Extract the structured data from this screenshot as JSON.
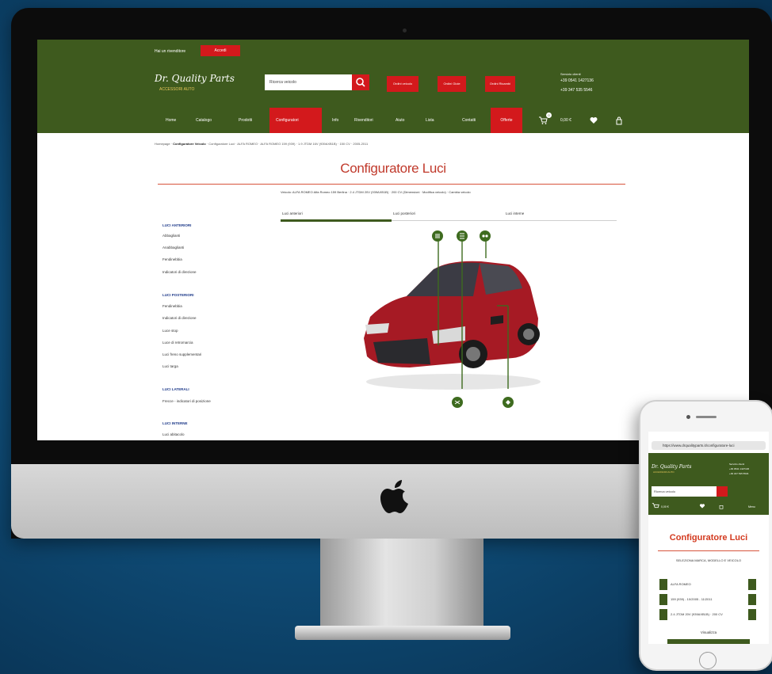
{
  "site": {
    "topbar_label": "Hai un rivenditore",
    "topbar_button": "Accedi",
    "logo_text": "Dr. Quality Parts",
    "logo_sub": "ACCESSORI AUTO",
    "search_placeholder": "Ricerca veicolo",
    "header_buttons": [
      "Ordini veicolo",
      "Ordini Gioie",
      "Ordini Ricambi"
    ],
    "contact_label": "Servizio clienti",
    "contact_lines": [
      "+39 0541 1427136",
      "+39 347 535 5546"
    ],
    "nav": [
      "Home",
      "Catalogo",
      "Prodotti",
      "Configuratori",
      "Info",
      "Rivenditori",
      "Aiuto",
      "Lista",
      "Contatti",
      "Offerte"
    ],
    "nav_active": "Configuratori",
    "nav_offer": "Offerte",
    "cart_count": "0",
    "cart_total": "0,00 €"
  },
  "breadcrumb": {
    "home": "Homepage",
    "section": "Configuratore Veicolo",
    "path": "Configuratore Luci · ALFA ROMEO · ALFA ROMEO 159 (939) · 1.9 JTDM 16V (939AXB1B) · 150 CV · 2005-2011"
  },
  "page": {
    "title": "Configuratore Luci",
    "note": "Veicolo: ALFA ROMEO Alfa Romeo 159 Berlina · 2.4 JTDM 20V (939AXB1B) · 200 CV (Dimensioni · Modifica veicolo) · Cambia veicolo"
  },
  "tabs": [
    "Luci anteriori",
    "Luci posteriori",
    "Luci interne"
  ],
  "sidebar": [
    {
      "group": "LUCI ANTERIORI",
      "items": [
        "Abbaglianti",
        "Anabbaglianti",
        "Fendinebbia",
        "Indicatori di direzione"
      ]
    },
    {
      "group": "LUCI POSTERIORI",
      "items": [
        "Fendinebbia",
        "Indicatori di direzione",
        "Luce stop",
        "Luce di retromarcia",
        "Luci freno supplementari",
        "Luci targa"
      ]
    },
    {
      "group": "LUCI LATERALI",
      "items": [
        "Frecce - indicatori di posizione"
      ]
    },
    {
      "group": "LUCI INTERNE",
      "items": [
        "Luci abitacolo"
      ]
    }
  ],
  "phone": {
    "url": "https://www.drqualityparts.it/configuratore-luci",
    "logo_text": "Dr. Quality Parts",
    "logo_sub": "ACCESSORI AUTO",
    "contact_lines": [
      "Servizio clienti",
      "+39 0541 1427136",
      "+39 347 535 5546"
    ],
    "search_placeholder": "Ricerca veicolo",
    "cart_total": "0,00 €",
    "menu_label": "Menu",
    "title": "Configuratore Luci",
    "selection_text": "SELEZIONA MARCA, MODELLO E VEICOLO",
    "rows": [
      "ALFA ROMEO",
      "159 (939) - 10/2005 - 11/2011",
      "2.4 JTDM 20V (939AXB1B) · 200 CV"
    ],
    "filter_label": "Visualizza"
  },
  "colors": {
    "header_green": "#3e5a1e",
    "brand_red": "#d3191c",
    "title_red": "#c0392b",
    "car_red": "#a61a24"
  }
}
